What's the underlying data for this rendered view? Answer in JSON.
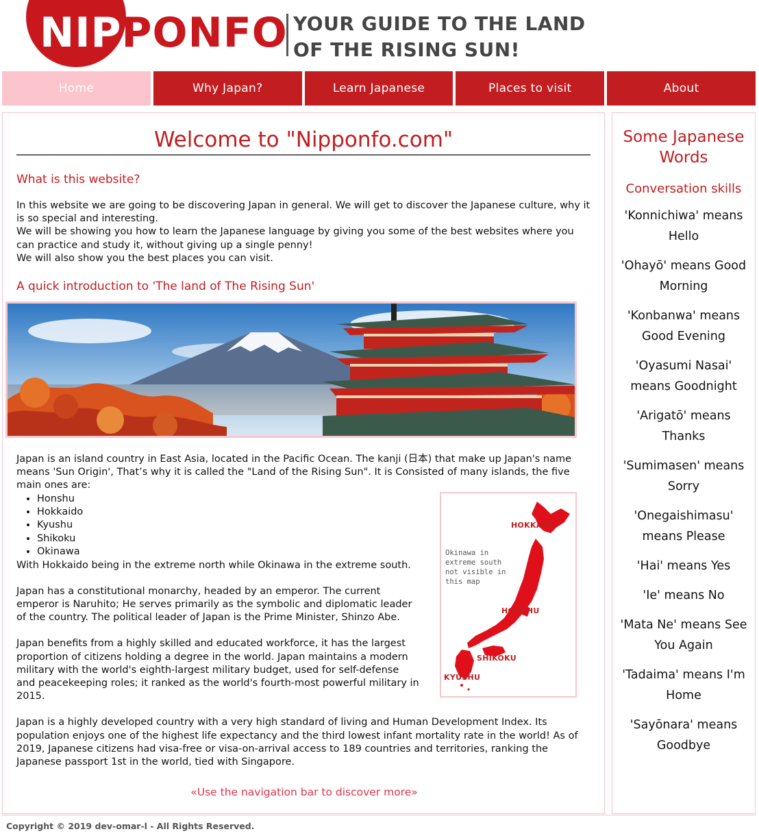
{
  "header": {
    "logo_white": "NIP",
    "logo_red": "PONFO",
    "tagline_line1": "YOUR GUIDE TO THE LAND",
    "tagline_line2": "OF THE RISING SUN!"
  },
  "nav": {
    "items": [
      {
        "label": "Home",
        "active": true
      },
      {
        "label": "Why Japan?"
      },
      {
        "label": "Learn Japanese"
      },
      {
        "label": "Places to visit"
      },
      {
        "label": "About"
      }
    ]
  },
  "main": {
    "title": "Welcome to \"Nipponfo.com\"",
    "section1_heading": "What is this website?",
    "section1_p1": "In this website we are going to be discovering Japan in general. We will get to discover the Japanese culture, why it is so special and interesting.",
    "section1_p2": "We will be showing you how to learn the Japanese language by giving you some of the best websites where you can practice and study it, without giving up a single penny!",
    "section1_p3": "We will also show you the best places you can visit.",
    "section2_heading": "A quick introduction to 'The land of The Rising Sun'",
    "intro_p": "Japan is an island country in East Asia, located in the Pacific Ocean. The kanji (日本) that make up Japan's name means 'Sun Origin', That’s why it is called the \"Land of the Rising Sun\". It is Consisted of many islands, the five main ones are:",
    "islands": [
      "Honshu",
      "Hokkaido",
      "Kyushu",
      "Shikoku",
      "Okinawa"
    ],
    "after_list": "With Hokkaido being in the extreme north while Okinawa in the extreme south.",
    "p_monarchy": "Japan has a constitutional monarchy, headed by an emperor. The current emperor is Naruhito; He serves primarily as the symbolic and diplomatic leader of the country. The political leader of Japan is the Prime Minister, Shinzo Abe.",
    "p_workforce": "Japan benefits from a highly skilled and educated workforce, it has the largest proportion of citizens holding a degree in the world. Japan maintains a modern military with the world's eighth-largest military budget, used for self-defense and peacekeeping roles; it ranked as the world's fourth-most powerful military in 2015.",
    "p_developed": "Japan is a highly developed country with a very high standard of living and Human Development Index. Its population enjoys one of the highest life expectancy and the third lowest infant mortality rate in the world! As of 2019, Japanese citizens had visa-free or visa-on-arrival access to 189 countries and territories, ranking the Japanese passport 1st in the world, tied with Singapore.",
    "cta": "«Use the navigation bar to discover more»",
    "map": {
      "note": "Okinawa in extreme south not visible in this map",
      "labels": {
        "hokkaido": "HOKKAIDO",
        "honshu": "HONSHU",
        "shikoku": "SHIKOKU",
        "kyushu": "KYUSHU"
      }
    }
  },
  "sidebar": {
    "title": "Some Japanese Words",
    "subtitle": "Conversation skills",
    "words": [
      "'Konnichiwa' means Hello",
      "'Ohayō' means Good Morning",
      "'Konbanwa' means Good Evening",
      "'Oyasumi Nasai' means Goodnight",
      "'Arigatō' means Thanks",
      "'Sumimasen' means Sorry",
      "'Onegaishimasu' means Please",
      "'Hai' means Yes",
      "'Ie' means No",
      "'Mata Ne' means See You Again",
      "'Tadaima' means I'm Home",
      "'Sayōnara' means Goodbye"
    ]
  },
  "footer": {
    "text": "Copyright © 2019 dev-omar-l - All Rights Reserved."
  },
  "colors": {
    "brand_red": "#c21d20",
    "nav_active": "#fcc4cd",
    "border_pink": "#f5c5cd",
    "cta_pink": "#e0334a"
  }
}
